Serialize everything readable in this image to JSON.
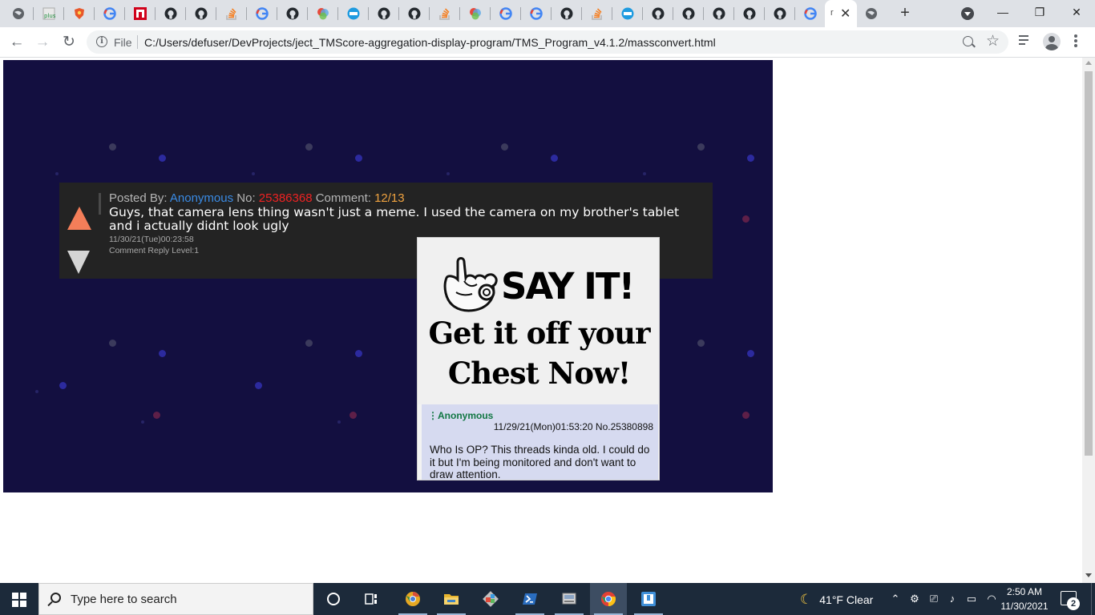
{
  "browser": {
    "tabs": [
      {
        "icon": "globe-icon"
      },
      {
        "icon": "plus-app-icon"
      },
      {
        "icon": "brave-shield-icon"
      },
      {
        "icon": "google-icon"
      },
      {
        "icon": "red-n-icon"
      },
      {
        "icon": "github-icon"
      },
      {
        "icon": "github-icon"
      },
      {
        "icon": "stackoverflow-icon"
      },
      {
        "icon": "google-icon"
      },
      {
        "icon": "github-icon"
      },
      {
        "icon": "colorful-app-icon"
      },
      {
        "icon": "edge-app-icon"
      },
      {
        "icon": "github-icon"
      },
      {
        "icon": "github-icon"
      },
      {
        "icon": "stackoverflow-icon"
      },
      {
        "icon": "colorful-app-icon"
      },
      {
        "icon": "google-icon"
      },
      {
        "icon": "google-icon"
      },
      {
        "icon": "github-icon"
      },
      {
        "icon": "stackoverflow-icon"
      },
      {
        "icon": "edge-app-icon"
      },
      {
        "icon": "github-icon"
      },
      {
        "icon": "github-icon"
      },
      {
        "icon": "github-icon"
      },
      {
        "icon": "github-icon"
      },
      {
        "icon": "google-icon"
      }
    ],
    "active_tab": {
      "favicon_text": "r",
      "close_label": "✕"
    },
    "after_active_tab_icon": "globe-icon",
    "new_tab_label": "+",
    "window_controls": {
      "minimize": "—",
      "maximize": "❐",
      "close": "✕"
    },
    "address": {
      "file_label": "File",
      "url": "C:/Users/defuser/DevProjects/ject_TMScore-aggregation-display-program/TMS_Program_v4.1.2/massconvert.html"
    }
  },
  "comment": {
    "posted_by_label": "Posted By: ",
    "author": "Anonymous",
    "no_label": " No: ",
    "post_no": "25386368",
    "comment_label": " Comment: ",
    "comment_count": "12/13",
    "text": "Guys, that camera lens thing wasn't just a meme. I used the camera on my brother's tablet and i actually didnt look ugly",
    "date": "11/30/21(Tue)00:23:58",
    "reply_level": "Comment Reply Level:1"
  },
  "attached_image": {
    "line1": "SAY IT!",
    "line2": "Get it off your",
    "line3": "Chest Now!",
    "post": {
      "menu_glyph": "⋮",
      "author": "Anonymous",
      "date_no": "11/29/21(Mon)01:53:20 No.25380898",
      "body": "Who Is OP? This threads kinda old. I could do it but I'm being monitored and don't want to draw attention."
    }
  },
  "colors": {
    "stage_bg": "#130f40",
    "comment_bg": "#232323",
    "upvote": "#f47e59",
    "downvote": "#d5d5d5",
    "author": "#3a8be5",
    "post_no": "#ee2222",
    "count": "#f0a340"
  },
  "taskbar": {
    "search_placeholder": "Type here to search",
    "weather": "41°F  Clear",
    "time": "2:50 AM",
    "date": "11/30/2021",
    "notification_count": "2",
    "apps": [
      {
        "icon": "cortana-circle-icon"
      },
      {
        "icon": "task-view-icon"
      },
      {
        "icon": "chrome-canary-icon"
      },
      {
        "icon": "file-explorer-icon"
      },
      {
        "icon": "git-icon"
      },
      {
        "icon": "powershell-icon"
      },
      {
        "icon": "disk-utility-icon"
      },
      {
        "icon": "chrome-icon"
      },
      {
        "icon": "app-window-icon"
      }
    ]
  }
}
